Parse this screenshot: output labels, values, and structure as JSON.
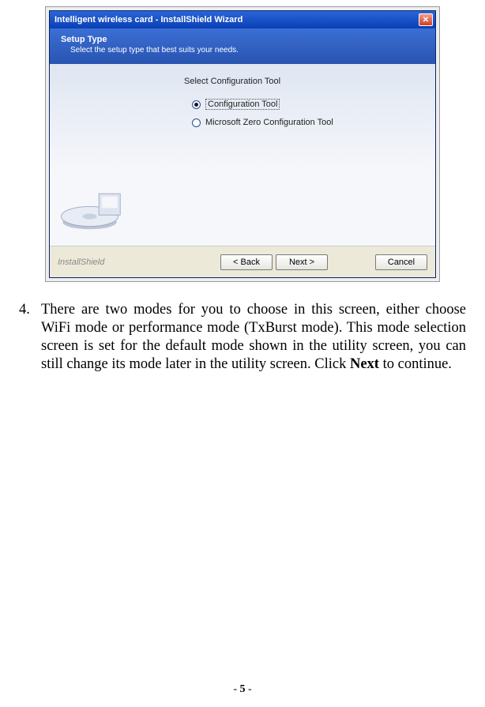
{
  "wizard": {
    "title": "Intelligent wireless card - InstallShield Wizard",
    "header": {
      "title": "Setup Type",
      "subtitle": "Select the setup type that best suits your needs."
    },
    "section_label": "Select Configuration Tool",
    "options": [
      {
        "label": "Configuration Tool",
        "selected": true
      },
      {
        "label": "Microsoft Zero Configuration Tool",
        "selected": false
      }
    ],
    "brand": "InstallShield",
    "buttons": {
      "back": "< Back",
      "next": "Next >",
      "cancel": "Cancel"
    }
  },
  "paragraph": {
    "number": "4.",
    "text_before_bold": "There are two modes for you to choose in this screen, either choose WiFi mode or performance mode (TxBurst mode). This mode selection screen is set for the default mode shown in the utility screen, you can still change its mode later in the utility screen. Click ",
    "bold": "Next",
    "text_after_bold": " to continue."
  },
  "page_number": "5"
}
